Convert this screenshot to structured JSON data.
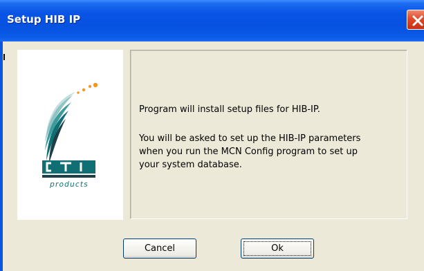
{
  "window": {
    "title": "Setup HIB IP",
    "close_icon": "close-icon"
  },
  "logo": {
    "brand": "CTI",
    "tagline": "products",
    "colors": {
      "orange": "#f7941d",
      "teal": "#0f6f73",
      "light_teal": "#8fc3c4",
      "dark": "#1f3f48"
    }
  },
  "message": {
    "line1": "Program will install setup files for HIB-IP.",
    "para2_line1": "You will be asked to set up the HIB-IP parameters",
    "para2_line2": "when you run the MCN Config program to set up",
    "para2_line3": "your system database."
  },
  "buttons": {
    "cancel_label": "Cancel",
    "ok_label": "Ok"
  },
  "colors": {
    "titlebar": "#0651e0",
    "dialog_bg": "#ece9d8",
    "close_red": "#d9462b"
  }
}
